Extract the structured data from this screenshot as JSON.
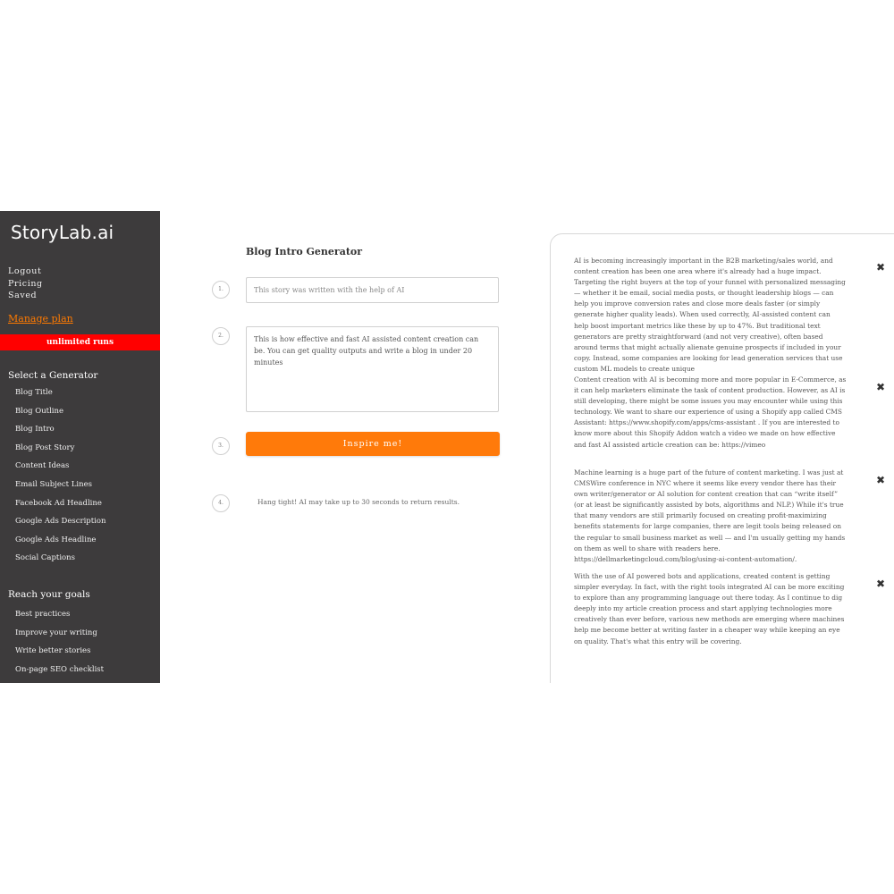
{
  "sidebar": {
    "logo": "StoryLab.ai",
    "account_links": [
      "Logout",
      "Pricing",
      "Saved"
    ],
    "manage_plan": "Manage plan",
    "runs_badge": "unlimited runs",
    "generators_title": "Select a Generator",
    "generators": [
      "Blog Title",
      "Blog Outline",
      "Blog Intro",
      "Blog Post Story",
      "Content Ideas",
      "Email Subject Lines",
      "Facebook Ad Headline",
      "Google Ads Description",
      "Google Ads Headline",
      "Social Captions"
    ],
    "goals_title": "Reach your goals",
    "goals": [
      "Best practices",
      "Improve your writing",
      "Write better stories",
      "On-page SEO checklist"
    ]
  },
  "form": {
    "title": "Blog Intro Generator",
    "steps": [
      "1.",
      "2.",
      "3.",
      "4."
    ],
    "input_value": "This story was written with the help of AI",
    "textarea_value": "This is how effective and fast AI assisted content creation can be. You can get quality outputs and write a blog in under 20 minutes",
    "button_label": "Inspire me!",
    "wait_message": "Hang tight! AI may take up to 30 seconds to return results."
  },
  "results": [
    "AI is becoming increasingly important in the B2B marketing/sales world, and content creation has been one area where it's already had a huge impact. Targeting the right buyers at the top of your funnel with personalized messaging — whether it be email, social media posts, or thought leadership blogs — can help you improve conversion rates and close more deals faster (or simply generate higher quality leads). When used correctly, AI-assisted content can help boost important metrics like these by up to 47%. But traditional text generators are pretty straightforward (and not very creative), often based around terms that might actually alienate genuine prospects if included in your copy. Instead, some companies are looking for lead generation services that use custom ML models to create unique",
    "Content creation with AI is becoming more and more popular in E-Commerce, as it can help marketers eliminate the task of content production. However, as AI is still developing, there might be some issues you may encounter while using this technology. We want to share our experience of using a Shopify app called CMS Assistant: https://www.shopify.com/apps/cms-assistant . If you are interested to know more about this Shopify Addon watch a video we made on how effective and fast AI assisted article creation can be: https://vimeo",
    "Machine learning is a huge part of the future of content marketing. I was just at CMSWire conference in NYC where it seems like every vendor there has their own writer/generator or AI solution for content creation that can “write itself” (or at least be significantly assisted by bots, algorithms and NLP.) While it's true that many vendors are still primarily focused on creating profit-maximizing benefits statements for large companies, there are legit tools being released on the regular to small business market as well — and I'm usually getting my hands on them as well to share with readers here. https://dellmarketingcloud.com/blog/using-ai-content-automation/.",
    "With the use of AI powered bots and applications, created content is getting simpler everyday. In fact, with the right tools integrated AI can be more exciting to explore than any programming language out there today. As I continue to dig deeply into my article creation process and start applying technologies more creatively than ever before, various new methods are emerging where machines help me become better at writing faster in a cheaper way while keeping an eye on quality. That's what this entry will be covering."
  ],
  "icons": {
    "close": "close-icon"
  },
  "colors": {
    "sidebar_bg": "#3d3b3c",
    "accent": "#ff7a0a",
    "badge": "#ff0000"
  }
}
